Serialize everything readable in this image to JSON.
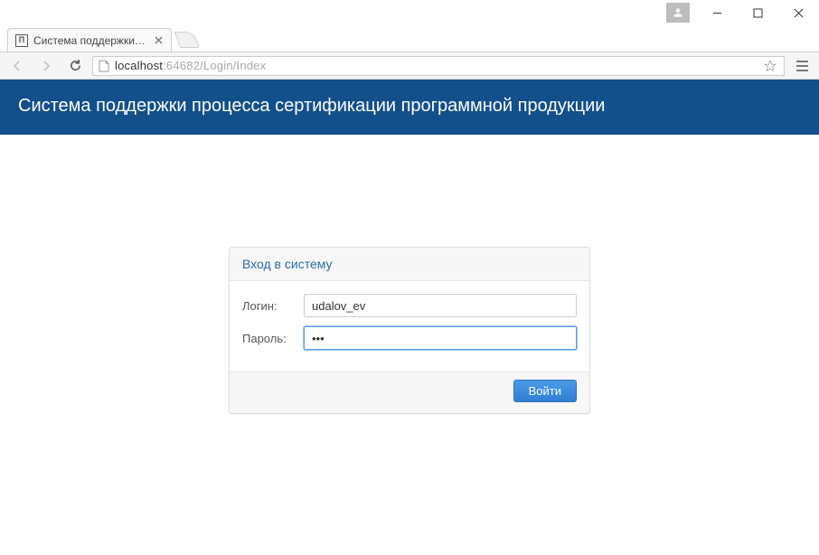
{
  "window": {
    "controls": {
      "min": "minimize",
      "max": "maximize",
      "close": "close"
    }
  },
  "browser": {
    "tab": {
      "title": "Система поддержки про",
      "favicon_text": "П"
    },
    "url_host": "localhost",
    "url_port": ":64682",
    "url_path": "/Login/Index"
  },
  "page": {
    "header_title": "Система поддержки процесса сертификации программной продукции",
    "login_panel": {
      "heading": "Вход в систему",
      "login_label": "Логин:",
      "login_value": "udalov_ev",
      "password_label": "Пароль:",
      "password_value": "•••",
      "submit_label": "Войти"
    }
  }
}
